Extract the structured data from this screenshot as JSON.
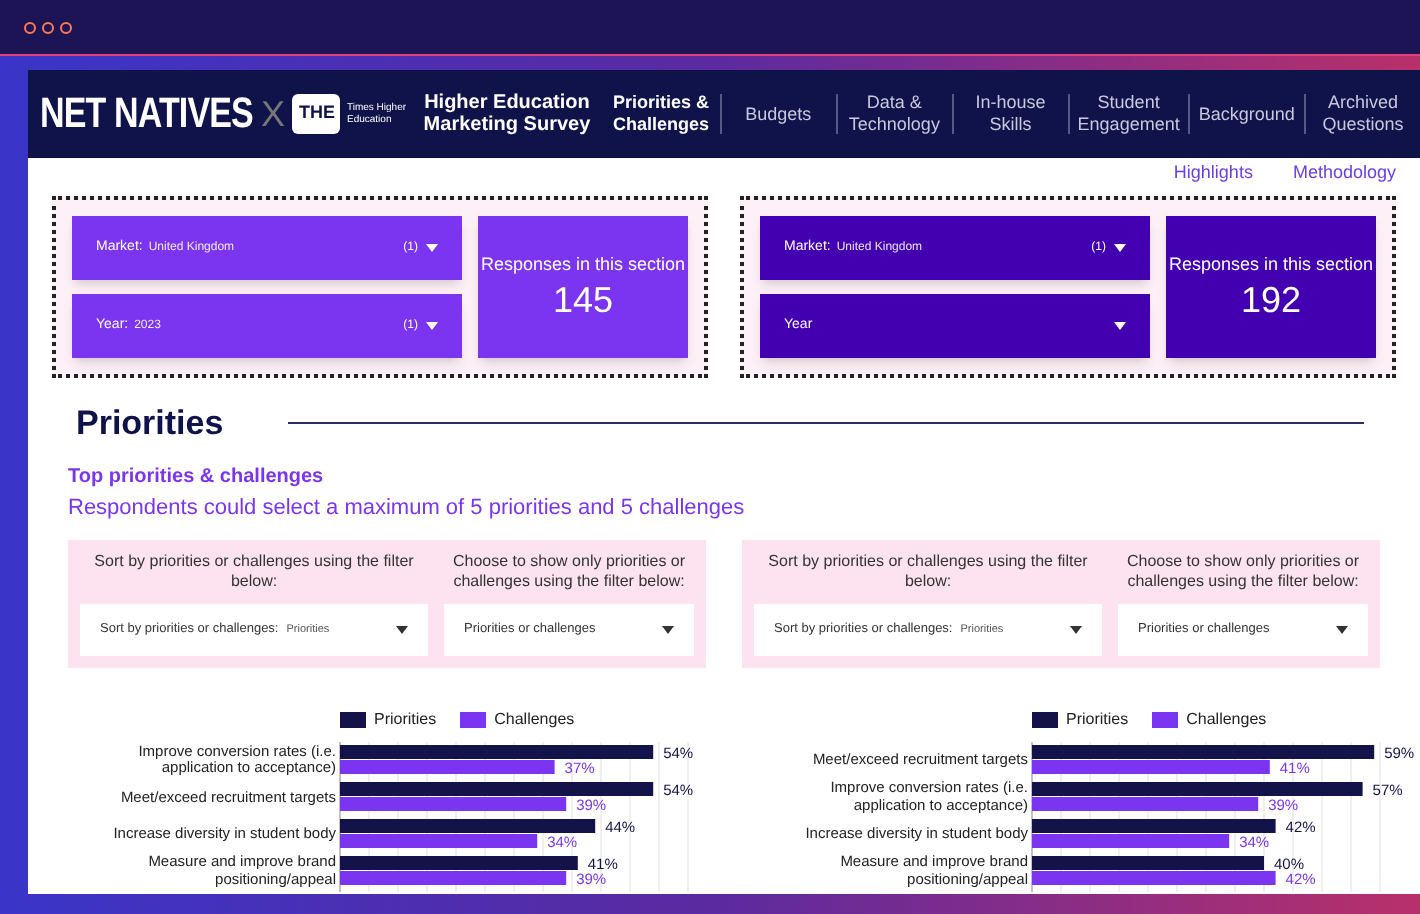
{
  "header": {
    "logo": "NET NATIVES",
    "cross": "X",
    "partner_badge": "THE",
    "partner_name": "Times Higher Education",
    "survey_title": "Higher Education Marketing Survey"
  },
  "nav": [
    {
      "label": "Priorities & Challenges",
      "selected": true
    },
    {
      "label": "Budgets",
      "selected": false
    },
    {
      "label": "Data & Technology",
      "selected": false
    },
    {
      "label": "In-house Skills",
      "selected": false
    },
    {
      "label": "Student Engagement",
      "selected": false
    },
    {
      "label": "Background",
      "selected": false
    },
    {
      "label": "Archived Questions",
      "selected": false
    }
  ],
  "links": [
    "Highlights",
    "Methodology"
  ],
  "filter_panels": [
    {
      "color": "#7b35f0",
      "filters": [
        {
          "label": "Market:",
          "value": "United Kingdom",
          "count": "(1)"
        },
        {
          "label": "Year:",
          "value": "2023",
          "count": "(1)"
        }
      ],
      "responses_label": "Responses in this section",
      "responses_value": "145"
    },
    {
      "color": "#4200b0",
      "filters": [
        {
          "label": "Market:",
          "value": "United Kingdom",
          "count": "(1)"
        },
        {
          "label": "Year"
        }
      ],
      "responses_label": "Responses in this section",
      "responses_value": "192"
    }
  ],
  "section_title": "Priorities",
  "subtitle": "Top priorities & challenges",
  "description": "Respondents could select a maximum of 5 priorities and 5 challenges",
  "sort_panels": [
    [
      {
        "prompt": "Sort by priorities or challenges using the filter below:",
        "dropdown_label": "Sort by priorities or challenges:",
        "dropdown_value": "Priorities"
      },
      {
        "prompt": "Choose to show only priorities or challenges using the filter below:",
        "dropdown_label": "Priorities or challenges"
      }
    ],
    [
      {
        "prompt": "Sort by priorities or challenges using the filter below:",
        "dropdown_label": "Sort by priorities or challenges:",
        "dropdown_value": "Priorities"
      },
      {
        "prompt": "Choose to show only priorities or challenges using the filter below:",
        "dropdown_label": "Priorities or challenges"
      }
    ]
  ],
  "charts": [
    {
      "chart_data": {
        "type": "bar",
        "orientation": "horizontal",
        "legend": "top",
        "categories": [
          "Improve conversion rates (i.e. application to acceptance)",
          "Meet/exceed recruitment targets",
          "Increase diversity in student body",
          "Measure and improve brand positioning/appeal"
        ],
        "series": [
          {
            "name": "Priorities",
            "color": "#13134a",
            "values": [
              54,
              54,
              44,
              41
            ],
            "value_labels": [
              "54%",
              "54%",
              "44%",
              "41%"
            ]
          },
          {
            "name": "Challenges",
            "color": "#7b35f0",
            "values": [
              37,
              39,
              34,
              39
            ],
            "value_labels": [
              "37%",
              "39%",
              "34%",
              "39%"
            ]
          }
        ]
      }
    },
    {
      "chart_data": {
        "type": "bar",
        "orientation": "horizontal",
        "legend": "top",
        "categories": [
          "Meet/exceed recruitment targets",
          "Improve conversion rates (i.e. application to acceptance)",
          "Increase diversity in student body",
          "Measure and improve brand positioning/appeal"
        ],
        "series": [
          {
            "name": "Priorities",
            "color": "#13134a",
            "values": [
              59,
              57,
              42,
              40
            ],
            "value_labels": [
              "59%",
              "57%",
              "42%",
              "40%"
            ]
          },
          {
            "name": "Challenges",
            "color": "#7b35f0",
            "values": [
              41,
              39,
              34,
              42
            ],
            "value_labels": [
              "41%",
              "39%",
              "34%",
              "42%"
            ]
          }
        ]
      }
    }
  ]
}
